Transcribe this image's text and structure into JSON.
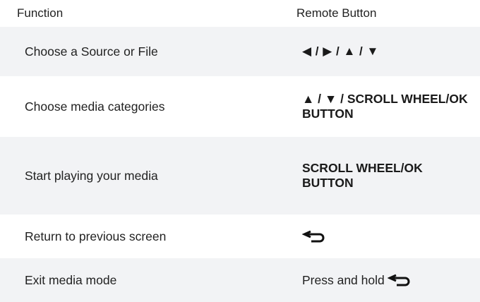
{
  "table": {
    "headers": {
      "function": "Function",
      "remote_button": "Remote Button"
    },
    "rows": [
      {
        "function": "Choose a Source or File",
        "button": "◀ / ▶ / ▲ / ▼",
        "style": "arrows",
        "shaded": true
      },
      {
        "function": "Choose media categories",
        "button": "▲ / ▼ / SCROLL WHEEL/OK BUTTON",
        "style": "bold",
        "shaded": false
      },
      {
        "function": "Start playing your media",
        "button": "SCROLL WHEEL/OK BUTTON",
        "style": "bold",
        "shaded": true
      },
      {
        "function": "Return to previous screen",
        "button_icon": "back-arrow-icon",
        "shaded": false
      },
      {
        "function": "Exit media mode",
        "button": "Press and hold",
        "button_icon": "back-arrow-icon",
        "shaded": true
      }
    ]
  }
}
